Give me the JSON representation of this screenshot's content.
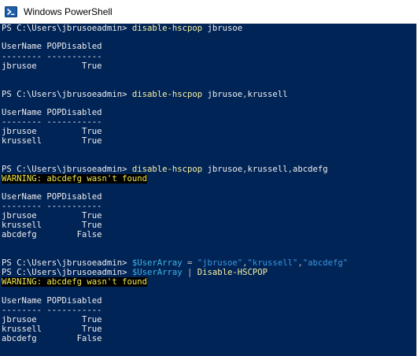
{
  "window": {
    "title": "Windows PowerShell",
    "icon": "powershell-icon"
  },
  "console": {
    "colors": {
      "background": "#012456",
      "text": "#eeedf0",
      "command": "#f9f1a5",
      "variable": "#3fb5e7",
      "string": "#3a96dd",
      "warning_text": "#f0e84a",
      "warning_bg": "#000000"
    },
    "line1": {
      "prompt": "PS C:\\Users\\jbrusoeadmin> ",
      "cmd": "disable-hscpop",
      "args": " jbrusoe"
    },
    "block1": {
      "header": "UserName POPDisabled",
      "separator": "-------- -----------",
      "rows": [
        "jbrusoe         True"
      ]
    },
    "line2": {
      "prompt": "PS C:\\Users\\jbrusoeadmin> ",
      "cmd": "disable-hscpop",
      "arg1": " jbrusoe",
      "sep": ",",
      "arg2": "krussell"
    },
    "block2": {
      "header": "UserName POPDisabled",
      "separator": "-------- -----------",
      "rows": [
        "jbrusoe         True",
        "krussell        True"
      ]
    },
    "line3": {
      "prompt": "PS C:\\Users\\jbrusoeadmin> ",
      "cmd": "disable-hscpop",
      "arg1": " jbrusoe",
      "sep1": ",",
      "arg2": "krussell",
      "sep2": ",",
      "arg3": "abcdefg"
    },
    "warning1": "WARNING: abcdefg wasn't found",
    "block3": {
      "header": "UserName POPDisabled",
      "separator": "-------- -----------",
      "rows": [
        "jbrusoe         True",
        "krussell        True",
        "abcdefg        False"
      ]
    },
    "line4": {
      "prompt": "PS C:\\Users\\jbrusoeadmin> ",
      "var": "$UserArray",
      "eq": " = ",
      "s1": "\"jbrusoe\"",
      "c1": ",",
      "s2": "\"krussell\"",
      "c2": ",",
      "s3": "\"abcdefg\""
    },
    "line5": {
      "prompt": "PS C:\\Users\\jbrusoeadmin> ",
      "var": "$UserArray",
      "pipe": " | ",
      "cmd": "Disable-HSCPOP"
    },
    "warning2": "WARNING: abcdefg wasn't found",
    "block4": {
      "header": "UserName POPDisabled",
      "separator": "-------- -----------",
      "rows": [
        "jbrusoe         True",
        "krussell        True",
        "abcdefg        False"
      ]
    }
  }
}
